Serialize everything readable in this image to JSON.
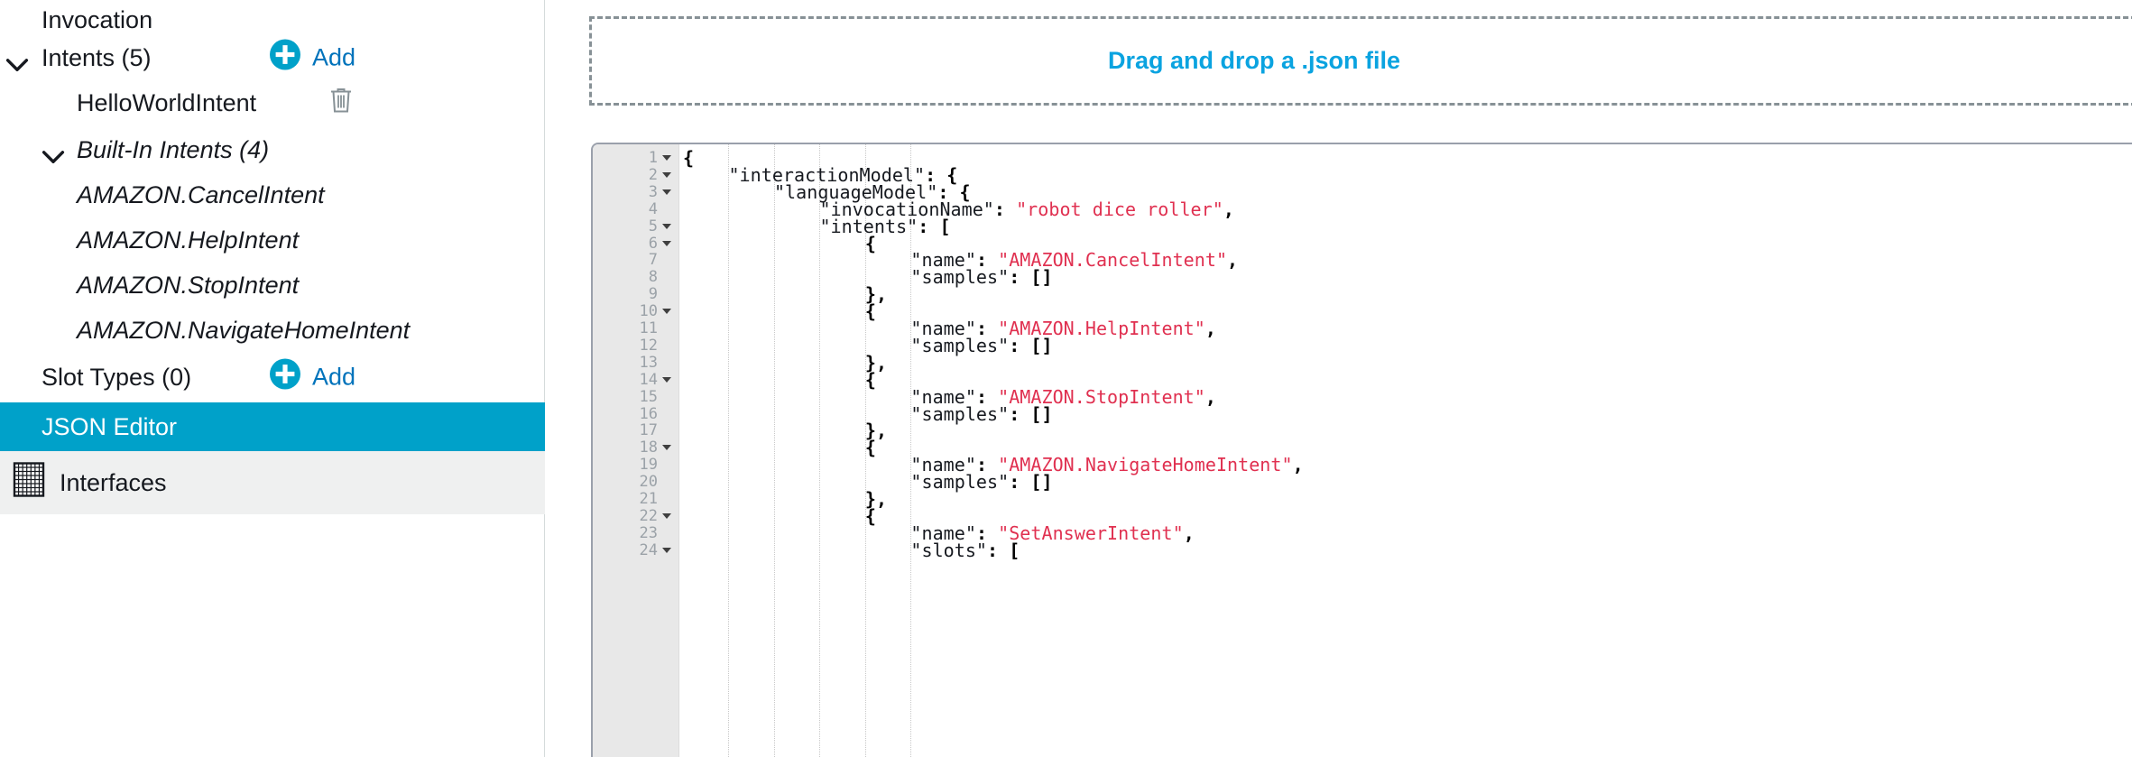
{
  "sidebar": {
    "items": [
      {
        "label": "Invocation",
        "level": 0,
        "italic": false,
        "caret": null,
        "selected": false,
        "add": null,
        "trash": false,
        "icon": null,
        "greyed": false
      },
      {
        "label": "Intents (5)",
        "level": 0,
        "italic": false,
        "caret": "down-level0",
        "selected": false,
        "add": "Add",
        "trash": false,
        "icon": null,
        "greyed": false
      },
      {
        "label": "HelloWorldIntent",
        "level": 1,
        "italic": false,
        "caret": null,
        "selected": false,
        "add": null,
        "trash": true,
        "icon": null,
        "greyed": false
      },
      {
        "label": "Built-In Intents (4)",
        "level": 2,
        "italic": true,
        "caret": "down-level1",
        "selected": false,
        "add": null,
        "trash": false,
        "icon": null,
        "greyed": false
      },
      {
        "label": "AMAZON.CancelIntent",
        "level": 1,
        "italic": true,
        "caret": null,
        "selected": false,
        "add": null,
        "trash": false,
        "icon": null,
        "greyed": false
      },
      {
        "label": "AMAZON.HelpIntent",
        "level": 1,
        "italic": true,
        "caret": null,
        "selected": false,
        "add": null,
        "trash": false,
        "icon": null,
        "greyed": false
      },
      {
        "label": "AMAZON.StopIntent",
        "level": 1,
        "italic": true,
        "caret": null,
        "selected": false,
        "add": null,
        "trash": false,
        "icon": null,
        "greyed": false
      },
      {
        "label": "AMAZON.NavigateHomeIntent",
        "level": 1,
        "italic": true,
        "caret": null,
        "selected": false,
        "add": null,
        "trash": false,
        "icon": null,
        "greyed": false
      },
      {
        "label": "Slot Types (0)",
        "level": 0,
        "italic": false,
        "caret": null,
        "selected": false,
        "add": "Add",
        "trash": false,
        "icon": null,
        "greyed": false
      },
      {
        "label": "JSON Editor",
        "level": 0,
        "italic": false,
        "caret": null,
        "selected": true,
        "add": null,
        "trash": false,
        "icon": null,
        "greyed": false
      },
      {
        "label": "Interfaces",
        "level": 0,
        "italic": false,
        "caret": null,
        "selected": false,
        "add": null,
        "trash": false,
        "icon": "interfaces-grid-icon",
        "greyed": true
      }
    ],
    "add_button_label": "Add",
    "icons": {
      "add": "plus-circle-icon",
      "delete": "trash-icon",
      "expand": "chevron-down-icon",
      "interfaces": "grid-icon"
    }
  },
  "dropzone": {
    "label": "Drag and drop a .json file"
  },
  "editor": {
    "first_visible_line": 1,
    "last_visible_line": 24,
    "indent_size": 4,
    "lines": [
      {
        "n": 1,
        "fold": true,
        "indent": 0,
        "tokens": [
          {
            "t": "brace",
            "v": "{"
          }
        ]
      },
      {
        "n": 2,
        "fold": true,
        "indent": 4,
        "tokens": [
          {
            "t": "key",
            "v": "\"interactionModel\""
          },
          {
            "t": "punct",
            "v": ": "
          },
          {
            "t": "brace",
            "v": "{"
          }
        ]
      },
      {
        "n": 3,
        "fold": true,
        "indent": 8,
        "tokens": [
          {
            "t": "key",
            "v": "\"languageModel\""
          },
          {
            "t": "punct",
            "v": ": "
          },
          {
            "t": "brace",
            "v": "{"
          }
        ]
      },
      {
        "n": 4,
        "fold": false,
        "indent": 12,
        "tokens": [
          {
            "t": "key",
            "v": "\"invocationName\""
          },
          {
            "t": "punct",
            "v": ": "
          },
          {
            "t": "str",
            "v": "\"robot dice roller\""
          },
          {
            "t": "punct",
            "v": ","
          }
        ]
      },
      {
        "n": 5,
        "fold": true,
        "indent": 12,
        "tokens": [
          {
            "t": "key",
            "v": "\"intents\""
          },
          {
            "t": "punct",
            "v": ": "
          },
          {
            "t": "brace",
            "v": "["
          }
        ]
      },
      {
        "n": 6,
        "fold": true,
        "indent": 16,
        "tokens": [
          {
            "t": "brace",
            "v": "{"
          }
        ]
      },
      {
        "n": 7,
        "fold": false,
        "indent": 20,
        "tokens": [
          {
            "t": "key",
            "v": "\"name\""
          },
          {
            "t": "punct",
            "v": ": "
          },
          {
            "t": "str",
            "v": "\"AMAZON.CancelIntent\""
          },
          {
            "t": "punct",
            "v": ","
          }
        ]
      },
      {
        "n": 8,
        "fold": false,
        "indent": 20,
        "tokens": [
          {
            "t": "key",
            "v": "\"samples\""
          },
          {
            "t": "punct",
            "v": ": "
          },
          {
            "t": "brace",
            "v": "[]"
          }
        ]
      },
      {
        "n": 9,
        "fold": false,
        "indent": 16,
        "tokens": [
          {
            "t": "brace",
            "v": "}"
          },
          {
            "t": "punct",
            "v": ","
          }
        ]
      },
      {
        "n": 10,
        "fold": true,
        "indent": 16,
        "tokens": [
          {
            "t": "brace",
            "v": "{"
          }
        ]
      },
      {
        "n": 11,
        "fold": false,
        "indent": 20,
        "tokens": [
          {
            "t": "key",
            "v": "\"name\""
          },
          {
            "t": "punct",
            "v": ": "
          },
          {
            "t": "str",
            "v": "\"AMAZON.HelpIntent\""
          },
          {
            "t": "punct",
            "v": ","
          }
        ]
      },
      {
        "n": 12,
        "fold": false,
        "indent": 20,
        "tokens": [
          {
            "t": "key",
            "v": "\"samples\""
          },
          {
            "t": "punct",
            "v": ": "
          },
          {
            "t": "brace",
            "v": "[]"
          }
        ]
      },
      {
        "n": 13,
        "fold": false,
        "indent": 16,
        "tokens": [
          {
            "t": "brace",
            "v": "}"
          },
          {
            "t": "punct",
            "v": ","
          }
        ]
      },
      {
        "n": 14,
        "fold": true,
        "indent": 16,
        "tokens": [
          {
            "t": "brace",
            "v": "{"
          }
        ]
      },
      {
        "n": 15,
        "fold": false,
        "indent": 20,
        "tokens": [
          {
            "t": "key",
            "v": "\"name\""
          },
          {
            "t": "punct",
            "v": ": "
          },
          {
            "t": "str",
            "v": "\"AMAZON.StopIntent\""
          },
          {
            "t": "punct",
            "v": ","
          }
        ]
      },
      {
        "n": 16,
        "fold": false,
        "indent": 20,
        "tokens": [
          {
            "t": "key",
            "v": "\"samples\""
          },
          {
            "t": "punct",
            "v": ": "
          },
          {
            "t": "brace",
            "v": "[]"
          }
        ]
      },
      {
        "n": 17,
        "fold": false,
        "indent": 16,
        "tokens": [
          {
            "t": "brace",
            "v": "}"
          },
          {
            "t": "punct",
            "v": ","
          }
        ]
      },
      {
        "n": 18,
        "fold": true,
        "indent": 16,
        "tokens": [
          {
            "t": "brace",
            "v": "{"
          }
        ]
      },
      {
        "n": 19,
        "fold": false,
        "indent": 20,
        "tokens": [
          {
            "t": "key",
            "v": "\"name\""
          },
          {
            "t": "punct",
            "v": ": "
          },
          {
            "t": "str",
            "v": "\"AMAZON.NavigateHomeIntent\""
          },
          {
            "t": "punct",
            "v": ","
          }
        ]
      },
      {
        "n": 20,
        "fold": false,
        "indent": 20,
        "tokens": [
          {
            "t": "key",
            "v": "\"samples\""
          },
          {
            "t": "punct",
            "v": ": "
          },
          {
            "t": "brace",
            "v": "[]"
          }
        ]
      },
      {
        "n": 21,
        "fold": false,
        "indent": 16,
        "tokens": [
          {
            "t": "brace",
            "v": "}"
          },
          {
            "t": "punct",
            "v": ","
          }
        ]
      },
      {
        "n": 22,
        "fold": true,
        "indent": 16,
        "tokens": [
          {
            "t": "brace",
            "v": "{"
          }
        ]
      },
      {
        "n": 23,
        "fold": false,
        "indent": 20,
        "tokens": [
          {
            "t": "key",
            "v": "\"name\""
          },
          {
            "t": "punct",
            "v": ": "
          },
          {
            "t": "str",
            "v": "\"SetAnswerIntent\""
          },
          {
            "t": "punct",
            "v": ","
          }
        ]
      },
      {
        "n": 24,
        "fold": true,
        "indent": 20,
        "tokens": [
          {
            "t": "key",
            "v": "\"slots\""
          },
          {
            "t": "punct",
            "v": ": "
          },
          {
            "t": "brace",
            "v": "["
          }
        ]
      }
    ]
  },
  "colors": {
    "accent_blue": "#00a1c9",
    "link_blue": "#0073bb",
    "dropzone_text": "#0aa3e0",
    "string_red": "#e03050",
    "gutter_bg": "#e8e8e8",
    "row_grey": "#eff0f0"
  }
}
